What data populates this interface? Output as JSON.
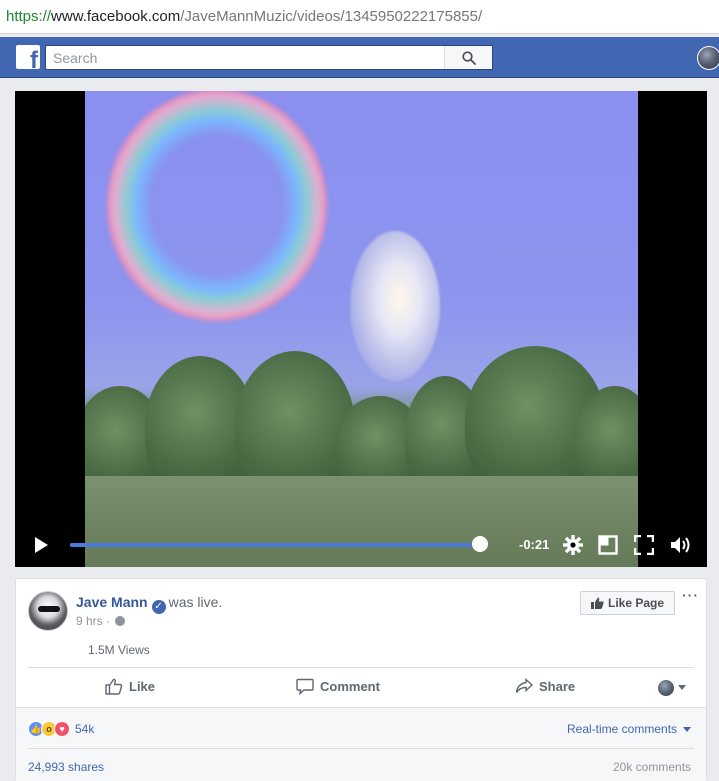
{
  "browser": {
    "url_scheme": "https://",
    "url_host": "www.facebook.com",
    "url_path": "/JaveMannMuzic/videos/1345950222175855/"
  },
  "fb_header": {
    "logo": "f",
    "search_placeholder": "Search",
    "search_icon": "search-icon"
  },
  "video": {
    "time_remaining": "-0:21",
    "progress": 0.98,
    "controls": [
      "play-icon",
      "gear-icon",
      "picture-in-picture-icon",
      "fullscreen-icon",
      "volume-icon"
    ]
  },
  "post": {
    "author": "Jave Mann",
    "action": "was live.",
    "time": "9 hrs",
    "separator": "·",
    "like_page_label": "Like Page",
    "more_label": "···",
    "views": "1.5M Views",
    "actions": {
      "like": "Like",
      "comment": "Comment",
      "share": "Share"
    },
    "reactions_count": "54k",
    "realtime_comments": "Real-time comments",
    "shares": "24,993 shares",
    "comments": "20k comments"
  },
  "colors": {
    "fb_blue": "#4267b2",
    "link_blue": "#365899",
    "progress_blue": "#4b7bd8"
  }
}
